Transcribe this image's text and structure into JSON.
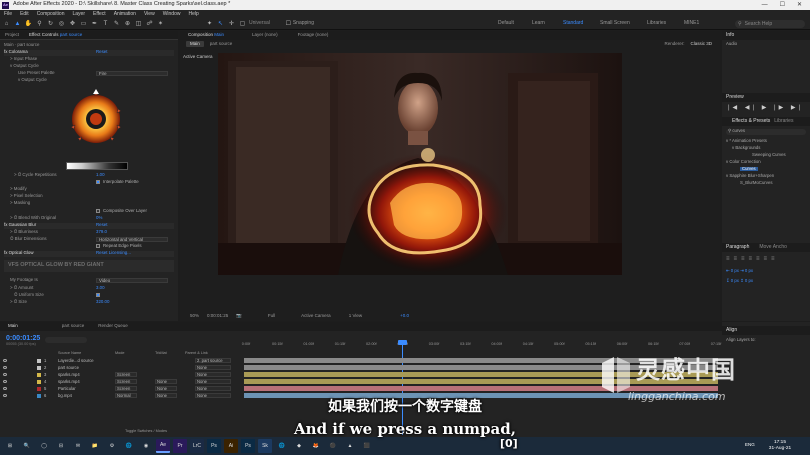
{
  "titlebar": {
    "app_icon": "Ae",
    "title": "Adobe After Effects 2020 - D:\\ Skillshare\\ 8. Master Class Creating Sparks\\sel.class.aep *",
    "controls": [
      "—",
      "☐",
      "✕"
    ]
  },
  "menu": [
    "File",
    "Edit",
    "Composition",
    "Layer",
    "Effect",
    "Animation",
    "View",
    "Window",
    "Help"
  ],
  "toolbar": {
    "snapping_label": "Snapping",
    "universal_label": "Universal",
    "workspaces": [
      "Default",
      "Learn",
      "Standard",
      "Small Screen",
      "Libraries",
      "MINE1"
    ],
    "active_workspace": "Standard",
    "search_placeholder": "Search Help"
  },
  "left_panel": {
    "tab_project": "Project",
    "tab_effect_controls": "Effect Controls",
    "tab_effect_controls_target": "part source",
    "layer_path": "Main · part source",
    "rows": [
      {
        "label": "fx  Colorama",
        "value": "Reset",
        "kind": "fx"
      },
      {
        "label": "> Input Phase",
        "value": ""
      },
      {
        "label": "v Output Cycle",
        "value": ""
      },
      {
        "label": "Use Preset Palette",
        "value": "Fire",
        "kind": "dd"
      },
      {
        "label": "v  Output Cycle",
        "value": ""
      }
    ],
    "rows2": [
      {
        "label": "> ⏱ Cycle Repetitions",
        "value": "1.00"
      },
      {
        "label": "",
        "check": "Interpolate Palette"
      },
      {
        "label": "> Modify",
        "value": ""
      },
      {
        "label": "> Pixel Selection",
        "value": ""
      },
      {
        "label": "> Masking",
        "value": ""
      },
      {
        "label": "",
        "check": "Composite Over Layer"
      },
      {
        "label": "> ⏱ Blend With Original",
        "value": "0%"
      },
      {
        "label": "fx  Gaussian Blur",
        "value": "Reset",
        "kind": "fx"
      },
      {
        "label": "> ⏱ Blurriness",
        "value": "379.0"
      },
      {
        "label": "⏱ Blur Dimensions",
        "value": "Horizontal and Vertical",
        "kind": "dd"
      },
      {
        "label": "",
        "check": "Repeat Edge Pixels"
      },
      {
        "label": "fx  Optical Glow",
        "value": "Reset   Licensing...",
        "kind": "fx"
      }
    ],
    "glow_banner": "VFS OPTICAL GLOW BY RED GIANT",
    "rows3": [
      {
        "label": "My Footage Is",
        "value": "Video",
        "kind": "dd"
      },
      {
        "label": "> ⏱ Amount",
        "value": "3.00"
      },
      {
        "label": "⏱ Uniform Size",
        "value": "",
        "check": ""
      },
      {
        "label": "> ⏱ Size",
        "value": "320.00"
      }
    ]
  },
  "comp_panel": {
    "tab": "Composition",
    "tab_target": "Main",
    "layer_tab": "Layer  (none)",
    "footage_tab": "Footage  (none)",
    "sub_tabs": [
      "Main",
      "part source"
    ],
    "renderer_label": "Renderer:",
    "renderer_value": "Classic 3D",
    "active_camera": "Active Camera",
    "controls": [
      "50%",
      "0:00:01:25",
      "📷",
      "Full",
      "Active Camera",
      "1 View",
      "+0.0"
    ]
  },
  "right_panel": {
    "info_title": "Info",
    "audio_title": "Audio",
    "preview_title": "Preview",
    "preview_buttons": [
      "|◀",
      "◀|",
      "▶",
      "|▶",
      "▶|"
    ],
    "effects_tab": "Effects & Presets",
    "libraries_tab": "Libraries",
    "search_value": "curves",
    "tree": [
      {
        "text": "v  * Animation Presets",
        "indent": 0
      },
      {
        "text": "v  Backgrounds",
        "indent": 1
      },
      {
        "text": "Sweeping Curves",
        "indent": 2
      },
      {
        "text": "v  Color Correction",
        "indent": 0
      },
      {
        "text": "Curves",
        "indent": 1,
        "selected": true
      },
      {
        "text": "v  Sapphire Blur+Sharpen",
        "indent": 0
      },
      {
        "text": "S_BlurMoCurves",
        "indent": 1
      }
    ],
    "paragraph_tab": "Paragraph",
    "move_anchor_tab": "Move Ancho",
    "align_title": "Align",
    "align_label": "Align Layers to:"
  },
  "timeline": {
    "tabs": [
      "Main",
      "part source",
      "Render Queue"
    ],
    "active_tab": "Main",
    "timecode": "0:00:01:25",
    "frames_label": "00055 (30.00 fps)",
    "columns": {
      "source": "Source Name",
      "mode": "Mode",
      "trkmat": "TrkMat",
      "parent": "Parent & Link"
    },
    "layers": [
      {
        "num": "1",
        "name": "Layerdie...d source",
        "mode": "",
        "trk": "",
        "parent": "2. part source",
        "color": "#c4c4c4"
      },
      {
        "num": "2",
        "name": "part source",
        "mode": "",
        "trk": "",
        "parent": "None",
        "color": "#c4c4c4"
      },
      {
        "num": "3",
        "name": "sparks.mp4",
        "mode": "Screen",
        "trk": "",
        "parent": "None",
        "color": "#d4b84a"
      },
      {
        "num": "4",
        "name": "sparks.mp4",
        "mode": "Screen",
        "trk": "None",
        "parent": "None",
        "color": "#d4b84a"
      },
      {
        "num": "5",
        "name": "Particular",
        "mode": "Screen",
        "trk": "None",
        "parent": "None",
        "color": "#b2282c"
      },
      {
        "num": "6",
        "name": "bg.mp4",
        "mode": "Normal",
        "trk": "None",
        "parent": "None",
        "color": "#3a88c4"
      }
    ],
    "ruler_ticks": [
      "0:00f",
      "00:15f",
      "01:00f",
      "01:15f",
      "02:00f",
      "02:15f",
      "03:00f",
      "03:15f",
      "04:00f",
      "04:15f",
      "05:00f",
      "05:15f",
      "06:00f",
      "06:15f",
      "07:00f",
      "07:15f"
    ],
    "toggle_label": "Toggle Switches / Modes"
  },
  "subtitles": {
    "chinese": "如果我们按一个数字键盘",
    "english": "And if we press a numpad,",
    "key": "[0]"
  },
  "watermark": {
    "cn": "灵感中国",
    "url": "lingganchina.com"
  },
  "taskbar": {
    "apps": [
      "⊞",
      "🔍",
      "◯",
      "⊟",
      "✉",
      "📁",
      "⚙",
      "🌐",
      "◉",
      "Ae",
      "Pr",
      "LrC",
      "Ps",
      "Ai",
      "Ps",
      "Sk",
      "🌐",
      "◆",
      "🦊",
      "⚫",
      "▲",
      "⬛"
    ],
    "lang": "ENG",
    "time": "17:15",
    "date": "31-Aug-21"
  },
  "colors": {
    "accent": "#3b8cff",
    "bg": "#232323",
    "panel_dark": "#1c1c1c",
    "taskbar": "#1b2a3a"
  }
}
